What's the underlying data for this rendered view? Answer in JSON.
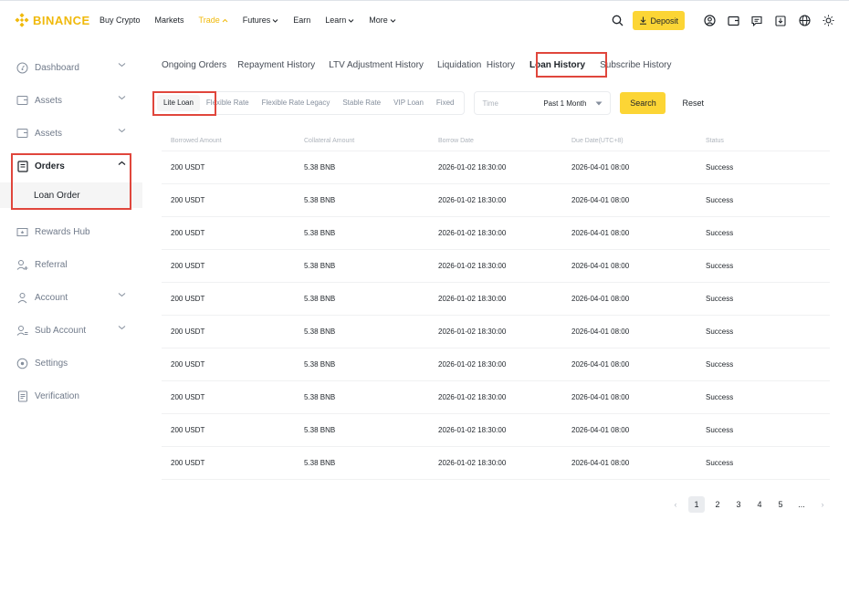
{
  "brand": {
    "name": "BINANCE",
    "color": "#f0b90b"
  },
  "nav": [
    {
      "label": "Buy Crypto",
      "caret": ""
    },
    {
      "label": "Markets",
      "caret": ""
    },
    {
      "label": "Trade",
      "caret": "^"
    },
    {
      "label": "Futures",
      "caret": "v"
    },
    {
      "label": "Earn",
      "caret": ""
    },
    {
      "label": "Learn",
      "caret": "v"
    },
    {
      "label": "More",
      "caret": "v"
    }
  ],
  "topbar": {
    "deposit_label": "Deposit",
    "deposit_icon": "download-icon"
  },
  "sidebar": {
    "items": [
      {
        "label": "Dashboard",
        "icon": "dashboard-icon"
      },
      {
        "label": "Assets",
        "icon": "wallet-icon"
      },
      {
        "label": "Assets",
        "icon": "wallet-icon"
      },
      {
        "label": "Orders",
        "icon": "orders-icon"
      },
      {
        "label": "Rewards Hub",
        "icon": "ticket-icon"
      },
      {
        "label": "Referral",
        "icon": "user-plus-icon"
      },
      {
        "label": "Account",
        "icon": "user-icon"
      },
      {
        "label": "Sub Account",
        "icon": "users-icon"
      },
      {
        "label": "Settings",
        "icon": "settings-icon"
      },
      {
        "label": "Verification",
        "icon": "document-icon"
      }
    ],
    "sub_item": "Loan Order"
  },
  "tabs": [
    "Ongoing Orders",
    "Repayment History",
    "LTV Adjustment History",
    "Liquidation  History",
    "Loan History",
    "Subscribe History"
  ],
  "filters": {
    "segments": [
      "Lite Loan",
      "Flexible Rate",
      "Flexible Rate Legacy",
      "Stable Rate",
      "VIP Loan",
      "Fixed"
    ],
    "time_label": "Time",
    "time_value": "Past 1 Month",
    "search_label": "Search",
    "reset_label": "Reset"
  },
  "table": {
    "headers": [
      "Borrowed Amount",
      "Collateral Amount",
      "Borrow Date",
      "Due Date(UTC+8)",
      "Status"
    ],
    "rows": [
      [
        "200 USDT",
        "5.38 BNB",
        "2026-01-02 18:30:00",
        "2026-04-01 08:00",
        "Success"
      ],
      [
        "200 USDT",
        "5.38 BNB",
        "2026-01-02 18:30:00",
        "2026-04-01 08:00",
        "Success"
      ],
      [
        "200 USDT",
        "5.38 BNB",
        "2026-01-02 18:30:00",
        "2026-04-01 08:00",
        "Success"
      ],
      [
        "200 USDT",
        "5.38 BNB",
        "2026-01-02 18:30:00",
        "2026-04-01 08:00",
        "Success"
      ],
      [
        "200 USDT",
        "5.38 BNB",
        "2026-01-02 18:30:00",
        "2026-04-01 08:00",
        "Success"
      ],
      [
        "200 USDT",
        "5.38 BNB",
        "2026-01-02 18:30:00",
        "2026-04-01 08:00",
        "Success"
      ],
      [
        "200 USDT",
        "5.38 BNB",
        "2026-01-02 18:30:00",
        "2026-04-01 08:00",
        "Success"
      ],
      [
        "200 USDT",
        "5.38 BNB",
        "2026-01-02 18:30:00",
        "2026-04-01 08:00",
        "Success"
      ],
      [
        "200 USDT",
        "5.38 BNB",
        "2026-01-02 18:30:00",
        "2026-04-01 08:00",
        "Success"
      ],
      [
        "200 USDT",
        "5.38 BNB",
        "2026-01-02 18:30:00",
        "2026-04-01 08:00",
        "Success"
      ]
    ]
  },
  "pagination": {
    "pages": [
      "1",
      "2",
      "3",
      "4",
      "5",
      "..."
    ],
    "prev": "‹",
    "next": "›"
  },
  "colors": {
    "accent": "#fcd535",
    "highlight": "#e0463c"
  }
}
